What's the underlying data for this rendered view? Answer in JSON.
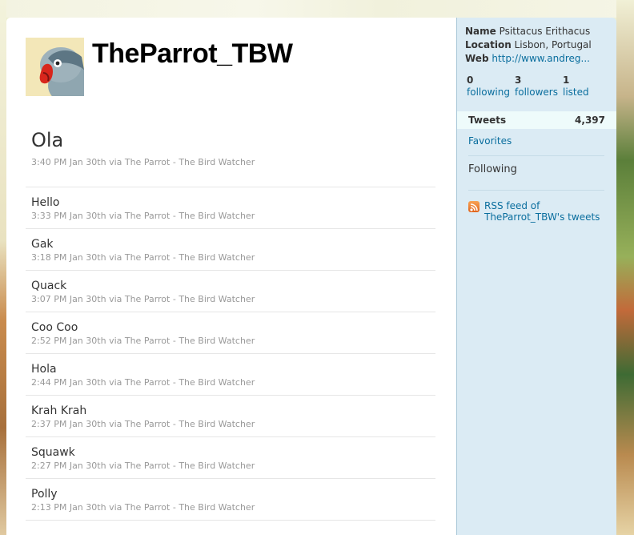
{
  "profile": {
    "screen_name": "TheParrot_TBW",
    "avatar_icon": "parrot-avatar"
  },
  "tweets": [
    {
      "text": "Ola",
      "time": "3:40 PM Jan 30th",
      "via": "via The Parrot - The Bird Watcher"
    },
    {
      "text": "Hello",
      "time": "3:33 PM Jan 30th",
      "via": "via The Parrot - The Bird Watcher"
    },
    {
      "text": "Gak",
      "time": "3:18 PM Jan 30th",
      "via": "via The Parrot - The Bird Watcher"
    },
    {
      "text": "Quack",
      "time": "3:07 PM Jan 30th",
      "via": "via The Parrot - The Bird Watcher"
    },
    {
      "text": "Coo Coo",
      "time": "2:52 PM Jan 30th",
      "via": "via The Parrot - The Bird Watcher"
    },
    {
      "text": "Hola",
      "time": "2:44 PM Jan 30th",
      "via": "via The Parrot - The Bird Watcher"
    },
    {
      "text": "Krah Krah",
      "time": "2:37 PM Jan 30th",
      "via": "via The Parrot - The Bird Watcher"
    },
    {
      "text": "Squawk",
      "time": "2:27 PM Jan 30th",
      "via": "via The Parrot - The Bird Watcher"
    },
    {
      "text": "Polly",
      "time": "2:13 PM Jan 30th",
      "via": "via The Parrot - The Bird Watcher"
    }
  ],
  "sidebar": {
    "name_label": "Name",
    "name_value": "Psittacus Erithacus",
    "location_label": "Location",
    "location_value": "Lisbon, Portugal",
    "web_label": "Web",
    "web_value": "http://www.andreg...",
    "following_count": "0",
    "following_label": "following",
    "followers_count": "3",
    "followers_label": "followers",
    "listed_count": "1",
    "listed_label": "listed",
    "tweets_label": "Tweets",
    "tweets_count": "4,397",
    "favorites_label": "Favorites",
    "following_section_label": "Following",
    "rss_line1": "RSS feed of",
    "rss_line2": "TheParrot_TBW's tweets",
    "rss_icon": "rss-icon"
  },
  "colors": {
    "link": "#0a6e9e",
    "sidebar_bg": "#dbebf4",
    "sidebar_border": "#a8c7d8"
  }
}
